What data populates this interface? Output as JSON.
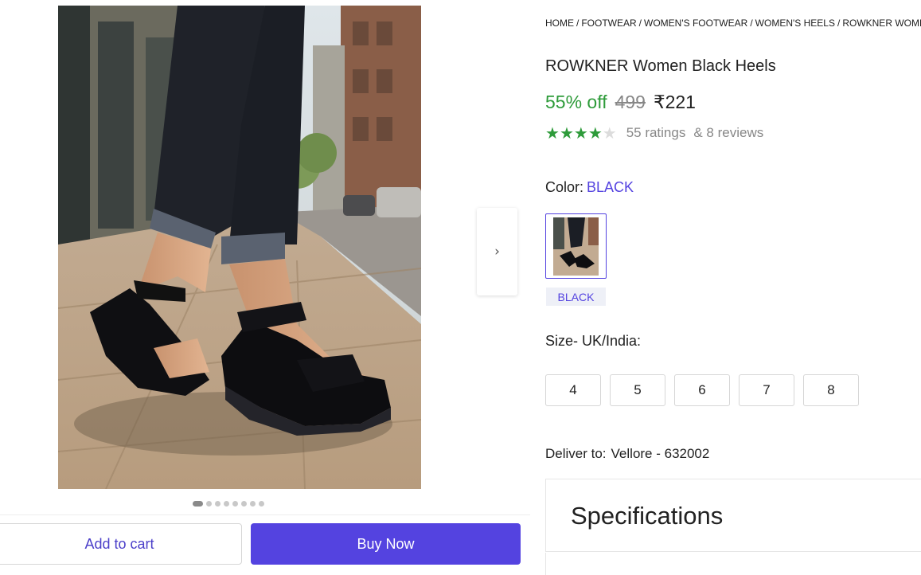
{
  "breadcrumb": [
    "HOME",
    "FOOTWEAR",
    "WOMEN'S FOOTWEAR",
    "WOMEN'S HEELS",
    "ROWKNER WOMEN BLACK HEELS"
  ],
  "product": {
    "title": "ROWKNER Women Black Heels",
    "discount": "55% off",
    "mrp": "499",
    "price": "₹221",
    "rating_value": 4,
    "rating_max": 5,
    "ratings_text": "55 ratings",
    "reviews_text": "& 8 reviews"
  },
  "color": {
    "label": "Color:",
    "selected": "BLACK",
    "options": [
      "BLACK"
    ]
  },
  "size": {
    "label": "Size- UK/India:",
    "options": [
      "4",
      "5",
      "6",
      "7",
      "8"
    ]
  },
  "delivery": {
    "label": "Deliver to:",
    "location": "Vellore - 632002"
  },
  "specifications": {
    "title": "Specifications"
  },
  "gallery": {
    "image_count": 8,
    "active_index": 0,
    "next_icon": "chevron-right-icon"
  },
  "actions": {
    "add_to_cart": "Add to cart",
    "buy_now": "Buy Now"
  },
  "colors": {
    "accent": "#5443e0",
    "discount_green": "#2e9b3a",
    "muted_gray": "#878787"
  }
}
